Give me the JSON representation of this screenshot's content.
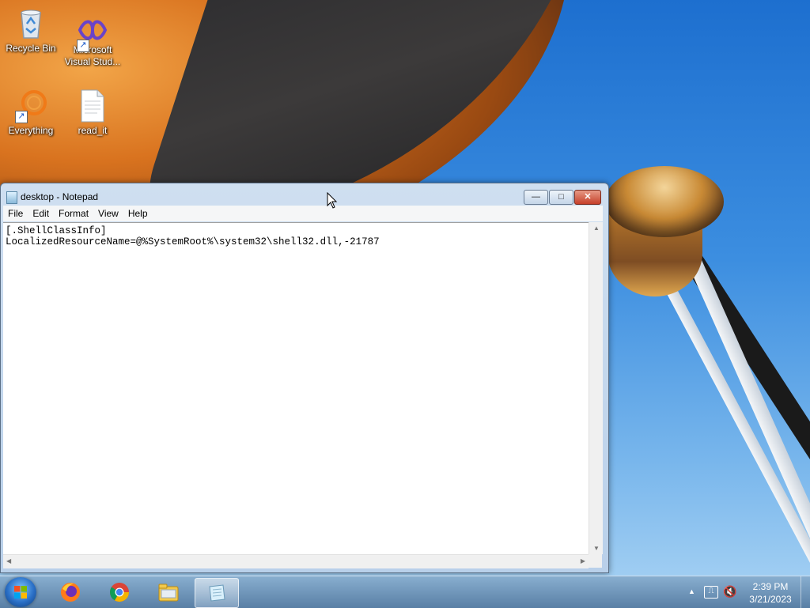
{
  "desktop": {
    "icons": [
      {
        "label": "Recycle Bin",
        "icon": "recycle-bin-icon"
      },
      {
        "label": "Microsoft\nVisual Stud...",
        "icon": "visual-studio-icon"
      },
      {
        "label": "Everything",
        "icon": "everything-search-icon"
      },
      {
        "label": "read_it",
        "icon": "text-file-icon"
      }
    ]
  },
  "window": {
    "title": "desktop - Notepad",
    "buttons": {
      "minimize": "—",
      "maximize": "□",
      "close": "✕"
    },
    "menu": [
      "File",
      "Edit",
      "Format",
      "View",
      "Help"
    ],
    "content": "[.ShellClassInfo]\nLocalizedResourceName=@%SystemRoot%\\system32\\shell32.dll,-21787"
  },
  "taskbar": {
    "apps": [
      "firefox-icon",
      "chrome-icon",
      "file-explorer-icon",
      "notepad-icon"
    ],
    "tray": {
      "arrow": "▲",
      "time": "2:39 PM",
      "date": "3/21/2023"
    }
  },
  "colors": {
    "accent": "#2a6fc6",
    "close_button": "#c6402a"
  }
}
